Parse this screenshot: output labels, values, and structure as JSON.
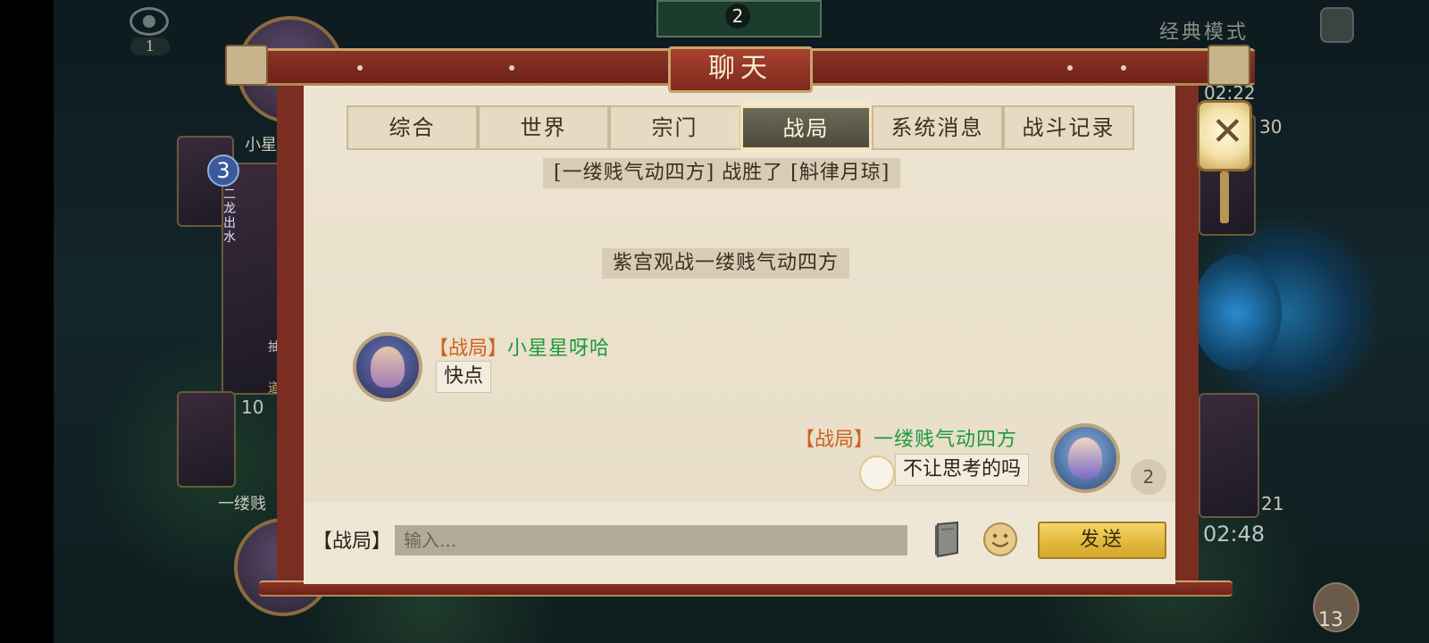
{
  "background": {
    "spectator_count": "1",
    "mode_label": "经典模式",
    "top_card_count": "2",
    "left_player": {
      "name_partial": "小星",
      "level": "3",
      "card_text": "二龙出水",
      "card_footer": "抽",
      "card_footer2": "道",
      "count": "10",
      "name_bottom": "一缕贱"
    },
    "right_player": {
      "top_time": "02:22",
      "count_top": "30",
      "count_bottom": "21",
      "timer": "02:48"
    },
    "bag_count": "13"
  },
  "dialog": {
    "title": "聊天",
    "tabs": [
      "综合",
      "世界",
      "宗门",
      "战局",
      "系统消息",
      "战斗记录"
    ],
    "active_tab": 3,
    "system_messages": [
      "[一缕贱气动四方] 战胜了 [斛律月琼]",
      "紫宫观战一缕贱气动四方"
    ],
    "messages": [
      {
        "side": "left",
        "channel": "【战局】",
        "sender": "小星星呀哈",
        "text": "快点"
      },
      {
        "side": "right",
        "channel": "【战局】",
        "sender": "一缕贱气动四方",
        "text": "不让思考的吗"
      }
    ],
    "unread_badge": "2",
    "input": {
      "channel_label": "【战局】",
      "placeholder": "输入..."
    },
    "send_label": "发送",
    "icons": {
      "close": "close-icon",
      "book": "book-icon",
      "emoji": "emoji-icon",
      "eye": "eye-icon",
      "menu": "menu-icon"
    },
    "colors": {
      "channel_tag": "#d0621e",
      "sender_name": "#1e9a3a",
      "send_button": "#e0b73a",
      "frame": "#7a2e22"
    }
  }
}
